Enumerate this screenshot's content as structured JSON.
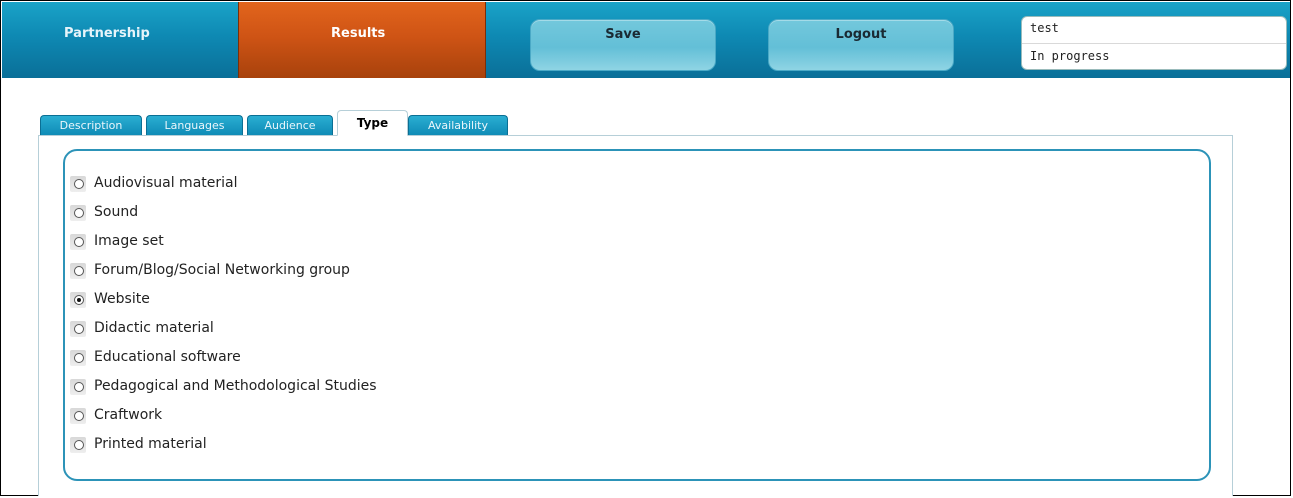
{
  "nav": {
    "partnership": "Partnership",
    "results": "Results",
    "save": "Save",
    "logout": "Logout"
  },
  "status": {
    "name": "test",
    "state": "In progress"
  },
  "tabs": {
    "description": "Description",
    "languages": "Languages",
    "audience": "Audience",
    "type": "Type",
    "availability": "Availability"
  },
  "options": [
    {
      "label": "Audiovisual material",
      "selected": false
    },
    {
      "label": "Sound",
      "selected": false
    },
    {
      "label": "Image set",
      "selected": false
    },
    {
      "label": "Forum/Blog/Social Networking group",
      "selected": false
    },
    {
      "label": "Website",
      "selected": true
    },
    {
      "label": "Didactic material",
      "selected": false
    },
    {
      "label": "Educational software",
      "selected": false
    },
    {
      "label": "Pedagogical and Methodological Studies",
      "selected": false
    },
    {
      "label": "Craftwork",
      "selected": false
    },
    {
      "label": "Printed material",
      "selected": false
    }
  ],
  "colors": {
    "nav_blue": "#0e89b3",
    "active_orange": "#cf5415",
    "panel_border": "#2c93b8"
  }
}
